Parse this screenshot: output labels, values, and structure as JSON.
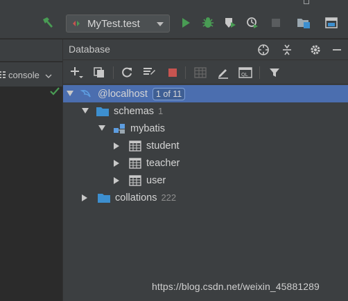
{
  "run_config": {
    "name": "MyTest.test"
  },
  "editor": {
    "console_tab_label": "console"
  },
  "database_panel": {
    "title": "Database",
    "tree": {
      "root": {
        "label": "@localhost",
        "badge": "1 of 11"
      },
      "schemas": {
        "label": "schemas",
        "count": "1"
      },
      "schema": {
        "label": "mybatis"
      },
      "tables": [
        "student",
        "teacher",
        "user"
      ],
      "collations": {
        "label": "collations",
        "count": "222"
      }
    }
  },
  "watermark": "https://blog.csdn.net/weixin_45881289",
  "colors": {
    "background": "#2b2b2b",
    "panel": "#3c3f41",
    "selection": "#4b6eaf",
    "run_green": "#499c54",
    "stop_red": "#c75450",
    "folder_blue": "#3d8fcf"
  }
}
